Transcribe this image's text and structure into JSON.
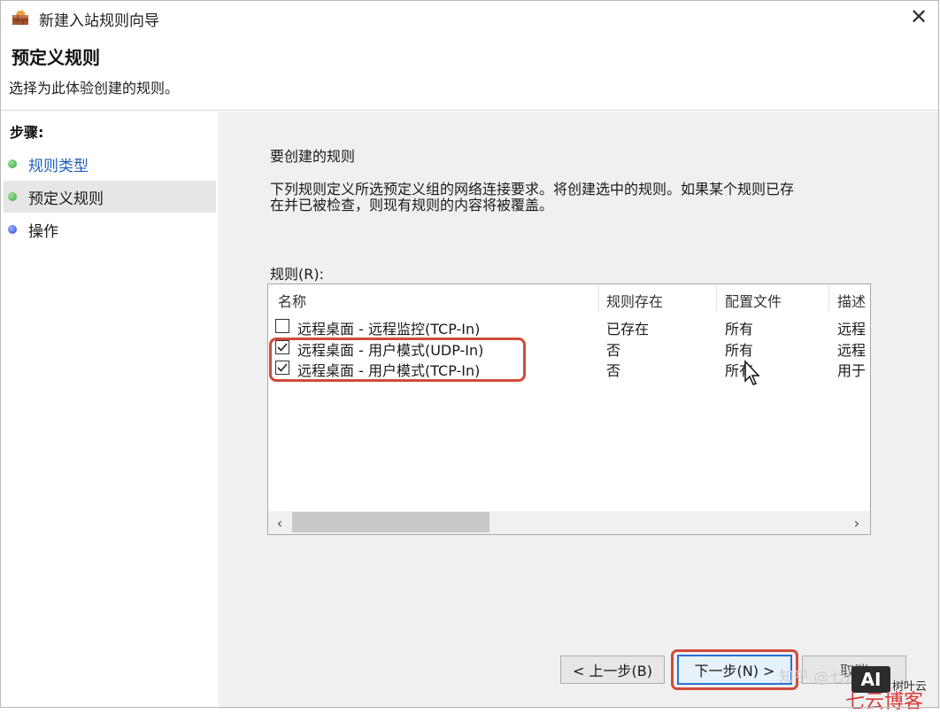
{
  "window": {
    "title": "新建入站规则向导",
    "close_glyph": "✕"
  },
  "header": {
    "title": "预定义规则",
    "subtitle": "选择为此体验创建的规则。"
  },
  "sidebar": {
    "steps_label": "步骤:",
    "steps": [
      {
        "label": "规则类型",
        "state": "completed"
      },
      {
        "label": "预定义规则",
        "state": "current"
      },
      {
        "label": "操作",
        "state": "pending"
      }
    ]
  },
  "main": {
    "section_title": "要创建的规则",
    "description": "下列规则定义所选预定义组的网络连接要求。将创建选中的规则。如果某个规则已存在并已被检查，则现有规则的内容将被覆盖。",
    "description_line1": "下列规则定义所选预定义组的网络连接要求。将创建选中的规则。如果某个规则已存",
    "description_line2": "在并已被检查，则现有规则的内容将被覆盖。",
    "rules_label": "规则(R):",
    "table": {
      "columns": [
        "名称",
        "规则存在",
        "配置文件",
        "描述"
      ],
      "rows": [
        {
          "checked": false,
          "name": "远程桌面 - 远程监控(TCP-In)",
          "exists": "已存在",
          "profile": "所有",
          "desc": "远程"
        },
        {
          "checked": true,
          "name": "远程桌面 - 用户模式(UDP-In)",
          "exists": "否",
          "profile": "所有",
          "desc": "远程"
        },
        {
          "checked": true,
          "name": "远程桌面 - 用户模式(TCP-In)",
          "exists": "否",
          "profile": "所有",
          "desc": "用于"
        }
      ]
    }
  },
  "buttons": {
    "back": "< 上一步(B)",
    "next": "下一步(N) >",
    "cancel": "取消"
  },
  "watermark": {
    "zhihu": "知乎 @七云数据",
    "box": "AI",
    "small": "树叶云",
    "large": "七云博客"
  },
  "colors": {
    "accent": "#2a6fd6",
    "highlight": "#d04a3a",
    "dot_completed": "#5cb85c",
    "dot_pending": "#3b5bd6",
    "link": "#1f5fbf"
  }
}
